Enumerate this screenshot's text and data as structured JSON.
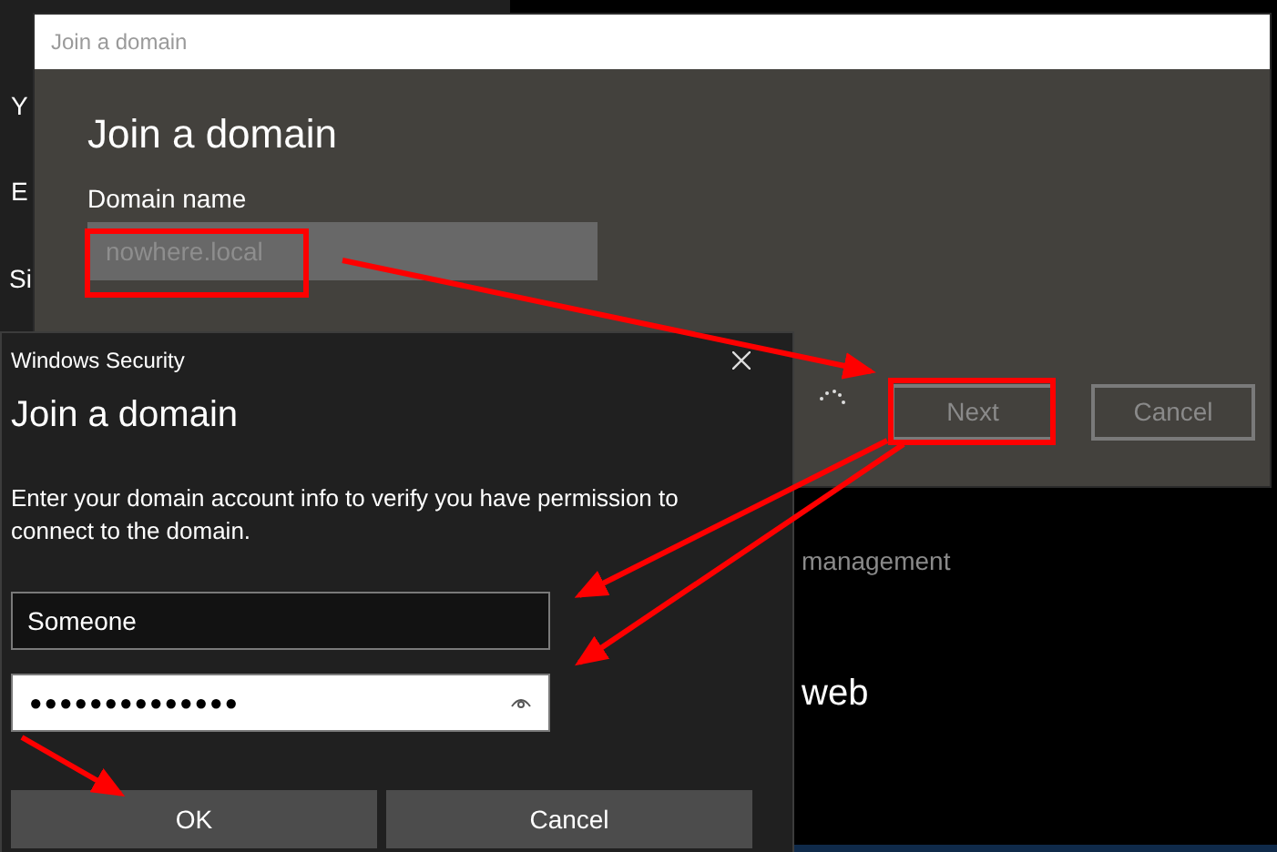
{
  "background": {
    "left_texts": [
      {
        "text": "Y"
      },
      {
        "text": "E"
      },
      {
        "text": "Si"
      }
    ],
    "right_texts": [
      {
        "kind": "item",
        "text": "management"
      },
      {
        "kind": "heading",
        "text": "web"
      }
    ]
  },
  "domain_dialog": {
    "title": "Join a domain",
    "heading": "Join a domain",
    "field_label": "Domain name",
    "domain_field": {
      "placeholder": "nowhere.local"
    },
    "buttons": [
      {
        "label": "Next",
        "disabled": true
      },
      {
        "label": "Cancel",
        "disabled": true
      }
    ]
  },
  "security_dialog": {
    "title": "Windows Security",
    "heading": "Join a domain",
    "message": "Enter your domain account info to verify you have permission to connect to the domain.",
    "username_field": {
      "value": "Someone"
    },
    "password_field": {
      "value": "●●●●●●●●●●●●●●"
    },
    "buttons": [
      {
        "label": "OK"
      },
      {
        "label": "Cancel"
      }
    ]
  }
}
